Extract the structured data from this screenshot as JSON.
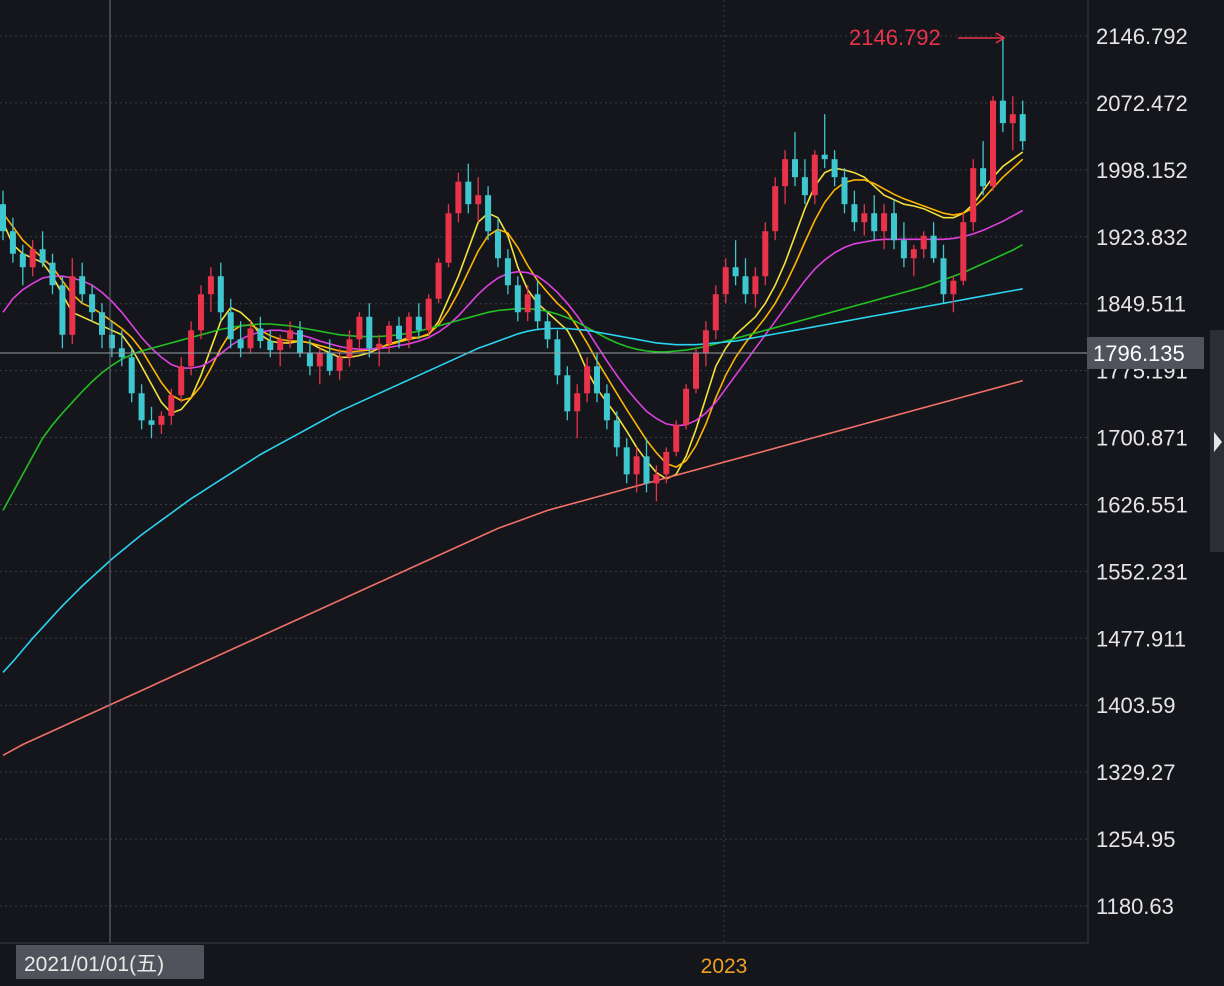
{
  "chart_data": {
    "type": "candlestick",
    "y_ticks": [
      "2146.792",
      "2072.472",
      "1998.152",
      "1923.832",
      "1849.511",
      "1775.191",
      "1700.871",
      "1626.551",
      "1552.231",
      "1477.911",
      "1403.59",
      "1329.27",
      "1254.95",
      "1180.63"
    ],
    "ylim": [
      1150,
      2170
    ],
    "current_price": "1796.135",
    "peak": {
      "label": "2146.792",
      "value": 2146.792
    },
    "crosshair_date": "2021/01/01(五)",
    "x_labels": [
      {
        "label": "2023"
      }
    ],
    "grid": true,
    "colors": {
      "up": "#e8334a",
      "down": "#3fc7cf",
      "background": "#14161c",
      "grid": "#3a3d45",
      "year_label": "#f0a020",
      "peak_label": "#e8334a"
    },
    "moving_averages": [
      {
        "color": "#f5e13a",
        "values": [
          1940,
          1915,
          1905,
          1900,
          1895,
          1880,
          1860,
          1840,
          1835,
          1830,
          1825,
          1820,
          1815,
          1800,
          1780,
          1760,
          1740,
          1728,
          1732,
          1745,
          1770,
          1800,
          1830,
          1845,
          1840,
          1830,
          1815,
          1808,
          1806,
          1806,
          1808,
          1806,
          1800,
          1795,
          1790,
          1790,
          1792,
          1795,
          1800,
          1805,
          1808,
          1812,
          1812,
          1815,
          1830,
          1855,
          1880,
          1910,
          1940,
          1950,
          1945,
          1925,
          1890,
          1865,
          1850,
          1840,
          1830,
          1820,
          1800,
          1775,
          1755,
          1740,
          1725,
          1708,
          1690,
          1675,
          1662,
          1655,
          1660,
          1680,
          1710,
          1745,
          1780,
          1800,
          1815,
          1825,
          1835,
          1850,
          1870,
          1895,
          1925,
          1955,
          1980,
          1995,
          2000,
          1998,
          1995,
          1990,
          1980,
          1970,
          1965,
          1960,
          1958,
          1955,
          1950,
          1945,
          1945,
          1950,
          1960,
          1975,
          1990,
          2002,
          2010,
          2018
        ]
      },
      {
        "color": "#ffb400",
        "values": [
          1950,
          1935,
          1920,
          1910,
          1900,
          1890,
          1875,
          1860,
          1850,
          1845,
          1838,
          1830,
          1822,
          1812,
          1798,
          1780,
          1762,
          1748,
          1742,
          1745,
          1758,
          1778,
          1800,
          1818,
          1825,
          1826,
          1820,
          1814,
          1810,
          1808,
          1808,
          1806,
          1803,
          1800,
          1797,
          1796,
          1797,
          1798,
          1801,
          1804,
          1807,
          1810,
          1812,
          1816,
          1826,
          1842,
          1862,
          1885,
          1908,
          1925,
          1932,
          1928,
          1912,
          1892,
          1875,
          1862,
          1850,
          1840,
          1824,
          1806,
          1786,
          1768,
          1750,
          1732,
          1715,
          1698,
          1684,
          1672,
          1668,
          1675,
          1692,
          1716,
          1745,
          1770,
          1790,
          1806,
          1820,
          1834,
          1850,
          1870,
          1893,
          1918,
          1942,
          1962,
          1976,
          1984,
          1987,
          1987,
          1983,
          1977,
          1971,
          1966,
          1962,
          1958,
          1954,
          1950,
          1948,
          1950,
          1956,
          1966,
          1978,
          1990,
          2000,
          2010
        ]
      },
      {
        "color": "#e040e0",
        "values": [
          1840,
          1855,
          1865,
          1872,
          1878,
          1880,
          1880,
          1878,
          1875,
          1870,
          1862,
          1852,
          1840,
          1826,
          1812,
          1800,
          1790,
          1782,
          1778,
          1778,
          1780,
          1786,
          1794,
          1803,
          1810,
          1815,
          1818,
          1820,
          1820,
          1818,
          1815,
          1812,
          1808,
          1805,
          1802,
          1800,
          1799,
          1799,
          1800,
          1801,
          1803,
          1805,
          1808,
          1812,
          1818,
          1826,
          1836,
          1848,
          1860,
          1870,
          1878,
          1883,
          1885,
          1884,
          1880,
          1872,
          1862,
          1850,
          1836,
          1820,
          1803,
          1786,
          1770,
          1755,
          1742,
          1730,
          1722,
          1716,
          1714,
          1715,
          1720,
          1728,
          1740,
          1755,
          1770,
          1785,
          1800,
          1815,
          1830,
          1845,
          1860,
          1875,
          1888,
          1898,
          1906,
          1912,
          1916,
          1918,
          1920,
          1921,
          1921,
          1921,
          1921,
          1921,
          1921,
          1921,
          1922,
          1924,
          1927,
          1931,
          1936,
          1941,
          1947,
          1953
        ]
      },
      {
        "color": "#22c022",
        "values": [
          1620,
          1640,
          1660,
          1680,
          1700,
          1715,
          1728,
          1740,
          1752,
          1763,
          1773,
          1781,
          1788,
          1793,
          1797,
          1800,
          1803,
          1806,
          1809,
          1812,
          1815,
          1818,
          1821,
          1823,
          1825,
          1826,
          1827,
          1827,
          1826,
          1825,
          1823,
          1821,
          1819,
          1817,
          1815,
          1814,
          1813,
          1813,
          1813,
          1814,
          1815,
          1817,
          1819,
          1822,
          1825,
          1828,
          1831,
          1834,
          1837,
          1840,
          1842,
          1843,
          1844,
          1844,
          1843,
          1841,
          1838,
          1834,
          1829,
          1823,
          1817,
          1811,
          1806,
          1802,
          1799,
          1797,
          1796,
          1796,
          1797,
          1798,
          1800,
          1802,
          1805,
          1808,
          1811,
          1814,
          1817,
          1820,
          1823,
          1826,
          1829,
          1832,
          1835,
          1838,
          1841,
          1844,
          1847,
          1850,
          1853,
          1856,
          1859,
          1862,
          1865,
          1868,
          1872,
          1876,
          1880,
          1884,
          1889,
          1894,
          1899,
          1904,
          1909,
          1915
        ]
      },
      {
        "color": "#2ad4f0",
        "values": [
          1440,
          1452,
          1465,
          1478,
          1490,
          1502,
          1514,
          1525,
          1536,
          1546,
          1556,
          1566,
          1575,
          1584,
          1593,
          1601,
          1609,
          1617,
          1625,
          1633,
          1640,
          1647,
          1654,
          1661,
          1668,
          1675,
          1682,
          1688,
          1694,
          1700,
          1706,
          1712,
          1718,
          1724,
          1730,
          1735,
          1740,
          1745,
          1750,
          1755,
          1760,
          1765,
          1770,
          1775,
          1780,
          1785,
          1790,
          1795,
          1800,
          1804,
          1808,
          1812,
          1816,
          1819,
          1821,
          1822,
          1822,
          1822,
          1821,
          1820,
          1818,
          1816,
          1814,
          1812,
          1810,
          1808,
          1806,
          1805,
          1804,
          1804,
          1804,
          1805,
          1806,
          1807,
          1808,
          1810,
          1812,
          1814,
          1816,
          1818,
          1820,
          1822,
          1824,
          1826,
          1828,
          1830,
          1832,
          1834,
          1836,
          1838,
          1840,
          1842,
          1844,
          1846,
          1848,
          1850,
          1852,
          1854,
          1856,
          1858,
          1860,
          1862,
          1864,
          1866
        ]
      },
      {
        "color": "#f07068",
        "values": [
          1348,
          1354,
          1360,
          1365,
          1370,
          1375,
          1380,
          1385,
          1390,
          1395,
          1400,
          1405,
          1410,
          1415,
          1420,
          1425,
          1430,
          1435,
          1440,
          1445,
          1450,
          1455,
          1460,
          1465,
          1470,
          1475,
          1480,
          1485,
          1490,
          1495,
          1500,
          1505,
          1510,
          1515,
          1520,
          1525,
          1530,
          1535,
          1540,
          1545,
          1550,
          1555,
          1560,
          1565,
          1570,
          1575,
          1580,
          1585,
          1590,
          1595,
          1600,
          1604,
          1608,
          1612,
          1616,
          1620,
          1623,
          1626,
          1629,
          1632,
          1635,
          1638,
          1641,
          1644,
          1647,
          1650,
          1653,
          1656,
          1659,
          1662,
          1665,
          1668,
          1671,
          1674,
          1677,
          1680,
          1683,
          1686,
          1689,
          1692,
          1695,
          1698,
          1701,
          1704,
          1707,
          1710,
          1713,
          1716,
          1719,
          1722,
          1725,
          1728,
          1731,
          1734,
          1737,
          1740,
          1743,
          1746,
          1749,
          1752,
          1755,
          1758,
          1761,
          1764
        ]
      }
    ],
    "candles": [
      [
        1960,
        1975,
        1920,
        1930
      ],
      [
        1930,
        1945,
        1895,
        1905
      ],
      [
        1905,
        1915,
        1870,
        1890
      ],
      [
        1890,
        1920,
        1880,
        1910
      ],
      [
        1910,
        1930,
        1890,
        1895
      ],
      [
        1895,
        1905,
        1860,
        1870
      ],
      [
        1870,
        1880,
        1800,
        1815
      ],
      [
        1815,
        1900,
        1805,
        1880
      ],
      [
        1880,
        1895,
        1850,
        1860
      ],
      [
        1860,
        1870,
        1830,
        1840
      ],
      [
        1840,
        1850,
        1800,
        1815
      ],
      [
        1815,
        1830,
        1790,
        1800
      ],
      [
        1800,
        1820,
        1780,
        1790
      ],
      [
        1790,
        1800,
        1740,
        1750
      ],
      [
        1750,
        1760,
        1710,
        1720
      ],
      [
        1720,
        1735,
        1700,
        1715
      ],
      [
        1715,
        1730,
        1705,
        1725
      ],
      [
        1725,
        1755,
        1715,
        1748
      ],
      [
        1748,
        1790,
        1740,
        1780
      ],
      [
        1780,
        1830,
        1770,
        1820
      ],
      [
        1820,
        1870,
        1810,
        1860
      ],
      [
        1860,
        1890,
        1840,
        1880
      ],
      [
        1880,
        1895,
        1830,
        1840
      ],
      [
        1840,
        1855,
        1800,
        1810
      ],
      [
        1810,
        1830,
        1790,
        1800
      ],
      [
        1800,
        1830,
        1795,
        1822
      ],
      [
        1822,
        1835,
        1800,
        1808
      ],
      [
        1808,
        1820,
        1790,
        1798
      ],
      [
        1798,
        1815,
        1780,
        1810
      ],
      [
        1810,
        1830,
        1800,
        1820
      ],
      [
        1820,
        1830,
        1790,
        1795
      ],
      [
        1795,
        1810,
        1770,
        1780
      ],
      [
        1780,
        1800,
        1760,
        1795
      ],
      [
        1795,
        1810,
        1770,
        1775
      ],
      [
        1775,
        1800,
        1765,
        1790
      ],
      [
        1790,
        1820,
        1780,
        1810
      ],
      [
        1810,
        1840,
        1800,
        1835
      ],
      [
        1835,
        1850,
        1790,
        1800
      ],
      [
        1800,
        1815,
        1780,
        1805
      ],
      [
        1805,
        1830,
        1795,
        1825
      ],
      [
        1825,
        1835,
        1800,
        1810
      ],
      [
        1810,
        1840,
        1800,
        1835
      ],
      [
        1835,
        1850,
        1810,
        1820
      ],
      [
        1820,
        1860,
        1815,
        1855
      ],
      [
        1855,
        1900,
        1850,
        1895
      ],
      [
        1895,
        1960,
        1890,
        1950
      ],
      [
        1950,
        1995,
        1940,
        1985
      ],
      [
        1985,
        2005,
        1950,
        1960
      ],
      [
        1960,
        1990,
        1940,
        1970
      ],
      [
        1970,
        1980,
        1920,
        1930
      ],
      [
        1930,
        1945,
        1890,
        1900
      ],
      [
        1900,
        1910,
        1860,
        1870
      ],
      [
        1870,
        1880,
        1830,
        1840
      ],
      [
        1840,
        1870,
        1830,
        1860
      ],
      [
        1860,
        1875,
        1820,
        1830
      ],
      [
        1830,
        1840,
        1800,
        1810
      ],
      [
        1810,
        1820,
        1760,
        1770
      ],
      [
        1770,
        1780,
        1720,
        1730
      ],
      [
        1730,
        1760,
        1700,
        1750
      ],
      [
        1750,
        1790,
        1740,
        1780
      ],
      [
        1780,
        1795,
        1740,
        1750
      ],
      [
        1750,
        1760,
        1710,
        1720
      ],
      [
        1720,
        1730,
        1680,
        1690
      ],
      [
        1690,
        1700,
        1650,
        1660
      ],
      [
        1660,
        1690,
        1640,
        1680
      ],
      [
        1680,
        1700,
        1640,
        1650
      ],
      [
        1650,
        1670,
        1630,
        1660
      ],
      [
        1660,
        1690,
        1650,
        1685
      ],
      [
        1685,
        1720,
        1680,
        1715
      ],
      [
        1715,
        1760,
        1710,
        1755
      ],
      [
        1755,
        1800,
        1750,
        1795
      ],
      [
        1795,
        1830,
        1780,
        1820
      ],
      [
        1820,
        1870,
        1810,
        1860
      ],
      [
        1860,
        1900,
        1850,
        1890
      ],
      [
        1890,
        1920,
        1870,
        1880
      ],
      [
        1880,
        1900,
        1850,
        1860
      ],
      [
        1860,
        1890,
        1845,
        1880
      ],
      [
        1880,
        1940,
        1870,
        1930
      ],
      [
        1930,
        1990,
        1920,
        1980
      ],
      [
        1980,
        2020,
        1960,
        2010
      ],
      [
        2010,
        2040,
        1980,
        1990
      ],
      [
        1990,
        2010,
        1960,
        1970
      ],
      [
        1970,
        2020,
        1960,
        2015
      ],
      [
        2015,
        2060,
        2000,
        2010
      ],
      [
        2010,
        2020,
        1980,
        1990
      ],
      [
        1990,
        2000,
        1950,
        1960
      ],
      [
        1960,
        1975,
        1930,
        1940
      ],
      [
        1940,
        1960,
        1925,
        1950
      ],
      [
        1950,
        1970,
        1920,
        1930
      ],
      [
        1930,
        1960,
        1910,
        1950
      ],
      [
        1950,
        1965,
        1910,
        1920
      ],
      [
        1920,
        1940,
        1890,
        1900
      ],
      [
        1900,
        1915,
        1880,
        1910
      ],
      [
        1910,
        1930,
        1900,
        1925
      ],
      [
        1925,
        1940,
        1895,
        1900
      ],
      [
        1900,
        1915,
        1850,
        1860
      ],
      [
        1860,
        1880,
        1840,
        1875
      ],
      [
        1875,
        1950,
        1870,
        1940
      ],
      [
        1940,
        2010,
        1930,
        2000
      ],
      [
        2000,
        2030,
        1970,
        1980
      ],
      [
        1980,
        2080,
        1975,
        2075
      ],
      [
        2075,
        2146.792,
        2040,
        2050
      ],
      [
        2050,
        2080,
        2020,
        2060
      ],
      [
        2060,
        2075,
        2020,
        2030
      ]
    ]
  }
}
